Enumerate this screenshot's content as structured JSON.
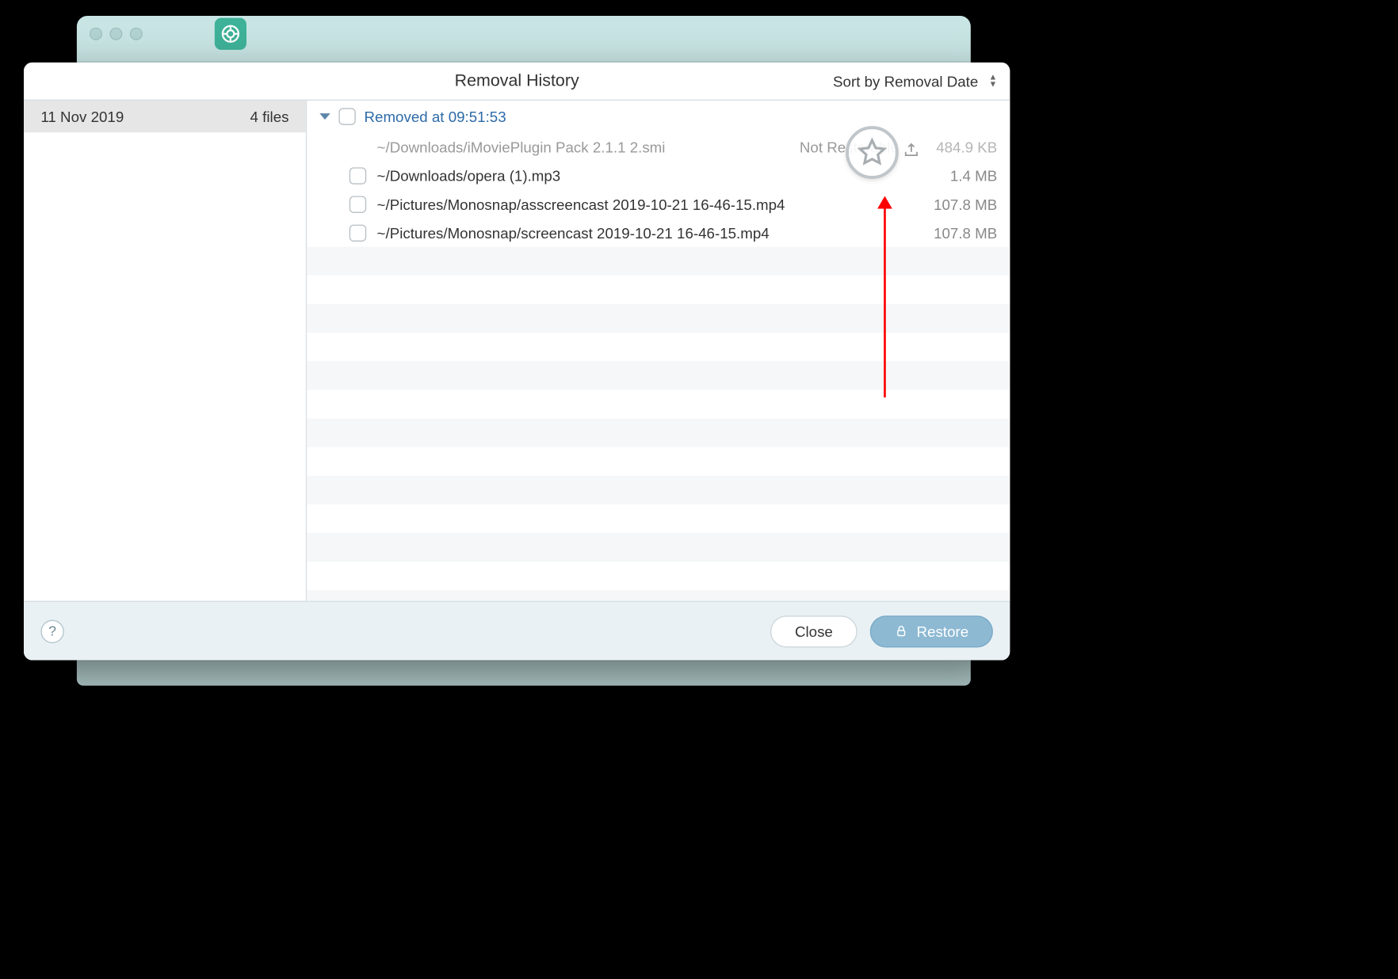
{
  "header": {
    "title": "Removal History",
    "sort_label": "Sort by Removal Date"
  },
  "sidebar": {
    "items": [
      {
        "date": "11 Nov 2019",
        "count": "4 files"
      }
    ]
  },
  "group": {
    "label": "Removed at 09:51:53"
  },
  "files": [
    {
      "path": "~/Downloads/iMoviePlugin Pack 2.1.1 2.smi",
      "status": "Not Restorable",
      "size": "484.9 KB",
      "disabled": true
    },
    {
      "path": "~/Downloads/opera (1).mp3",
      "status": "",
      "size": "1.4 MB",
      "disabled": false
    },
    {
      "path": "~/Pictures/Monosnap/asscreencast 2019-10-21 16-46-15.mp4",
      "status": "",
      "size": "107.8 MB",
      "disabled": false
    },
    {
      "path": "~/Pictures/Monosnap/screencast 2019-10-21 16-46-15.mp4",
      "status": "",
      "size": "107.8 MB",
      "disabled": false
    }
  ],
  "footer": {
    "help": "?",
    "close": "Close",
    "restore": "Restore"
  }
}
